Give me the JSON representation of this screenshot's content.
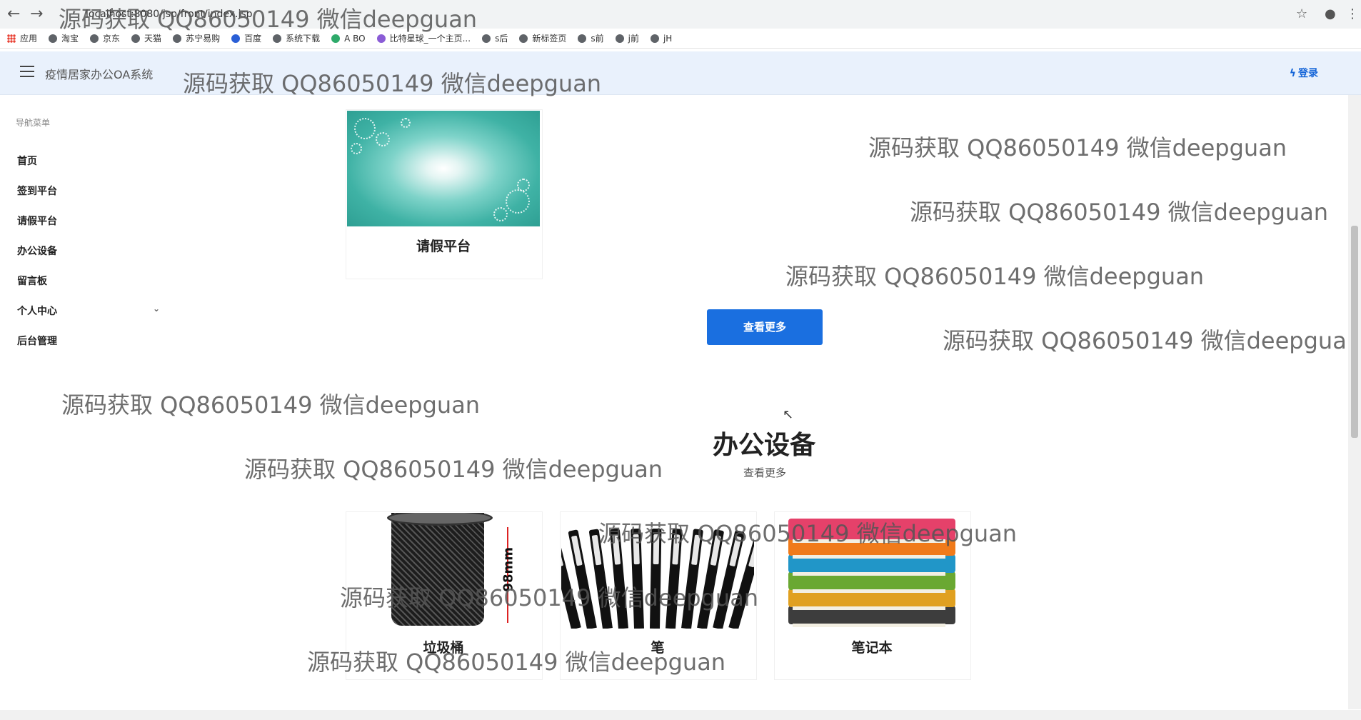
{
  "browser": {
    "url": "localhost:8080/jsp/front/index.jsp",
    "bookmarks": [
      "应用",
      "淘宝",
      "京东",
      "天猫",
      "苏宁易购",
      "百度",
      "系统下载",
      "A BO",
      "比特星球_一个主页...",
      "s后",
      "新标签页",
      "s前",
      "j前",
      "jH"
    ]
  },
  "header": {
    "title": "疫情居家办公OA系统",
    "login": "登录"
  },
  "sidebar": {
    "heading": "导航菜单",
    "items": [
      {
        "label": "首页"
      },
      {
        "label": "签到平台"
      },
      {
        "label": "请假平台"
      },
      {
        "label": "办公设备"
      },
      {
        "label": "留言板"
      },
      {
        "label": "个人中心"
      },
      {
        "label": "后台管理"
      }
    ]
  },
  "main": {
    "leave_card": {
      "title": "请假平台"
    },
    "more_button": "查看更多",
    "section": {
      "title": "办公设备",
      "more": "查看更多"
    },
    "products": [
      {
        "name": "垃圾桶",
        "dimension": "98mm"
      },
      {
        "name": "笔"
      },
      {
        "name": "笔记本"
      }
    ]
  },
  "watermark": "源码获取 QQ86050149 微信deepguan",
  "colors": {
    "header_bg": "#e9f1fc",
    "accent": "#1a6fe0"
  }
}
